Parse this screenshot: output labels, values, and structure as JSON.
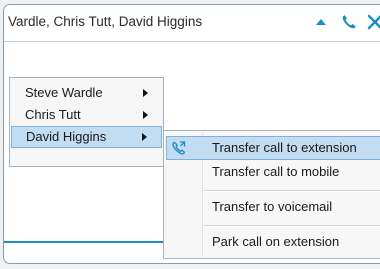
{
  "window": {
    "title": "Vardle, Chris Tutt, David Higgins"
  },
  "colors": {
    "accent": "#1a8ec6",
    "selection": "#c2dcf2",
    "selection_border": "#7fb2e0"
  },
  "icons": {
    "collapse": "chevron-up-icon",
    "call": "phone-icon",
    "close": "close-icon",
    "transfer": "phone-transfer-icon",
    "submenu": "triangle-right-icon"
  },
  "contact_menu": {
    "items": [
      {
        "label": "Steve Wardle",
        "has_submenu": true,
        "selected": false
      },
      {
        "label": "Chris Tutt",
        "has_submenu": true,
        "selected": false
      },
      {
        "label": "David Higgins",
        "has_submenu": true,
        "selected": true
      }
    ]
  },
  "transfer_menu": {
    "items": [
      {
        "label": "Transfer call to extension",
        "selected": true
      },
      {
        "label": "Transfer call to mobile",
        "selected": false
      },
      {
        "label": "Transfer to voicemail",
        "selected": false
      },
      {
        "label": "Park call on extension",
        "selected": false
      }
    ]
  }
}
